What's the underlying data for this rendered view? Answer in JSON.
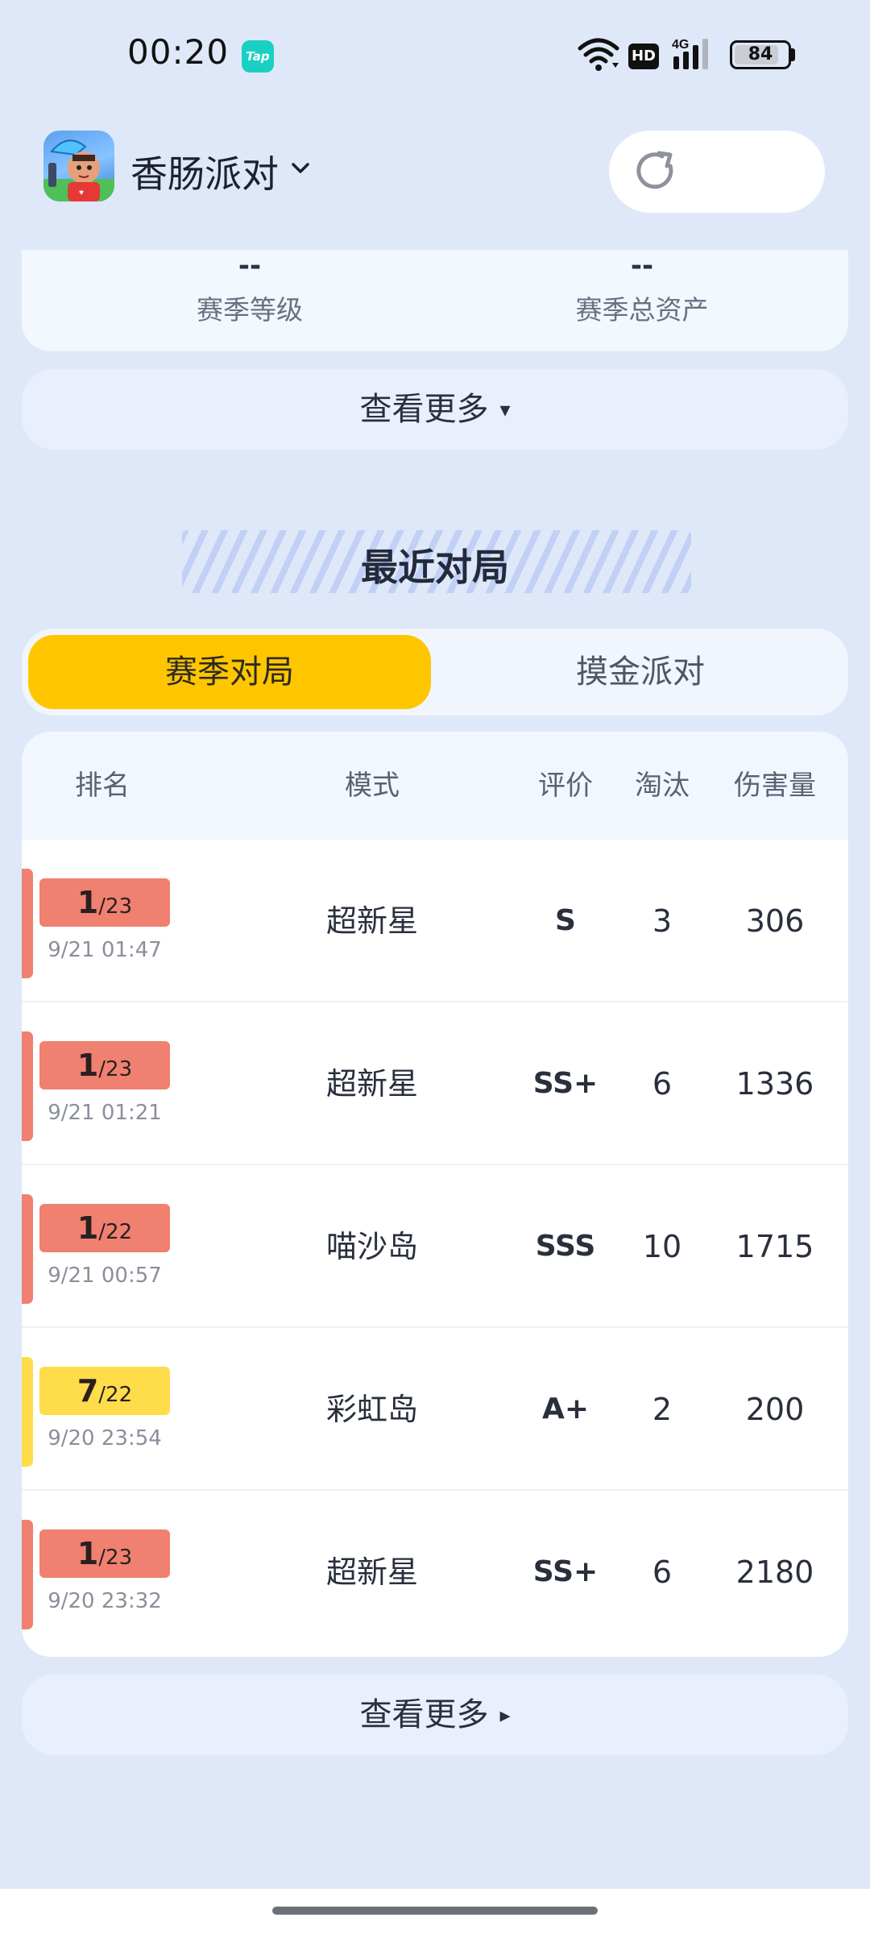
{
  "status_bar": {
    "time": "00:20",
    "app_badge": "Tap",
    "network": "HD",
    "battery": 84
  },
  "header": {
    "game_title": "香肠派对"
  },
  "stats": {
    "items": [
      {
        "value": "--",
        "label": "赛季等级"
      },
      {
        "value": "--",
        "label": "赛季总资产"
      }
    ]
  },
  "more_stats": {
    "label": "查看更多",
    "arrow": "▾"
  },
  "section": {
    "title": "最近对局"
  },
  "tabs": [
    {
      "label": "赛季对局",
      "active": true
    },
    {
      "label": "摸金派对",
      "active": false
    }
  ],
  "table": {
    "headers": {
      "rank": "排名",
      "mode": "模式",
      "rating": "评价",
      "eliminations": "淘汰",
      "damage": "伤害量"
    },
    "rows": [
      {
        "rank": "1",
        "total": "/23",
        "date": "9/21 01:47",
        "mode": "超新星",
        "rating": "S",
        "eliminations": "3",
        "damage": "306",
        "color": "#f08070"
      },
      {
        "rank": "1",
        "total": "/23",
        "date": "9/21 01:21",
        "mode": "超新星",
        "rating": "SS+",
        "eliminations": "6",
        "damage": "1336",
        "color": "#f08070"
      },
      {
        "rank": "1",
        "total": "/22",
        "date": "9/21 00:57",
        "mode": "喵沙岛",
        "rating": "SSS",
        "eliminations": "10",
        "damage": "1715",
        "color": "#f08070"
      },
      {
        "rank": "7",
        "total": "/22",
        "date": "9/20 23:54",
        "mode": "彩虹岛",
        "rating": "A+",
        "eliminations": "2",
        "damage": "200",
        "color": "#ffdc4a"
      },
      {
        "rank": "1",
        "total": "/23",
        "date": "9/20 23:32",
        "mode": "超新星",
        "rating": "SS+",
        "eliminations": "6",
        "damage": "2180",
        "color": "#f08070"
      }
    ]
  },
  "more_matches": {
    "label": "查看更多",
    "arrow": "▸"
  },
  "colors": {
    "accent_tab": "#ffc600",
    "rank_first": "#f08070",
    "rank_other": "#ffdc4a",
    "background": "#dfe8f8"
  },
  "icons": {
    "refresh": "refresh-icon",
    "dropdown": "chevron-down-icon",
    "wifi": "wifi-icon",
    "signal": "signal-icon",
    "battery": "battery-icon"
  }
}
